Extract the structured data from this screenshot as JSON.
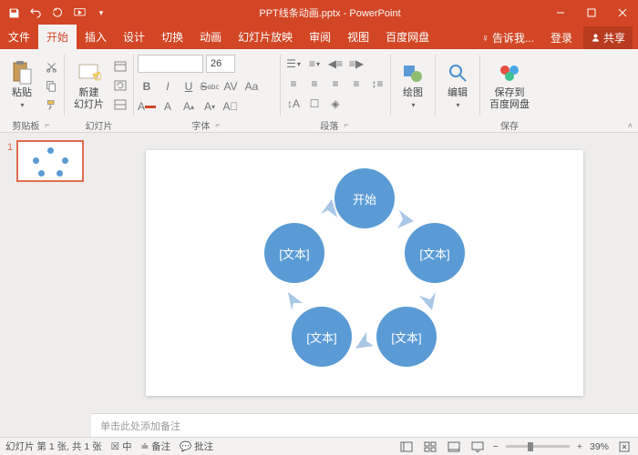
{
  "titlebar": {
    "title": "PPT线条动画.pptx - PowerPoint"
  },
  "tabs": {
    "file": "文件",
    "home": "开始",
    "insert": "插入",
    "design": "设计",
    "transitions": "切换",
    "animations": "动画",
    "slideshow": "幻灯片放映",
    "review": "审阅",
    "view": "视图",
    "baidu": "百度网盘",
    "tellme": "告诉我...",
    "login": "登录",
    "share": "共享"
  },
  "ribbon": {
    "clipboard": {
      "paste": "粘贴",
      "label": "剪贴板"
    },
    "slides": {
      "newSlide": "新建\n幻灯片",
      "label": "幻灯片"
    },
    "font": {
      "fontSize": "26",
      "label": "字体",
      "B": "B",
      "I": "I",
      "U": "U",
      "S": "S",
      "AV": "AV",
      "Aa": "Aa",
      "Ag": "A",
      "Al": "A"
    },
    "paragraph": {
      "label": "段落"
    },
    "drawing": {
      "draw": "绘图",
      "label": ""
    },
    "editing": {
      "edit": "编辑",
      "label": ""
    },
    "save": {
      "saveTo": "保存到\n百度网盘",
      "label": "保存"
    }
  },
  "thumbs": {
    "num": "1"
  },
  "slide": {
    "nodes": [
      "开始",
      "[文本]",
      "[文本]",
      "[文本]",
      "[文本]"
    ]
  },
  "notes": {
    "placeholder": "单击此处添加备注"
  },
  "statusbar": {
    "slideInfo": "幻灯片 第 1 张, 共 1 张",
    "lang": "",
    "notes": "备注",
    "comments": "批注",
    "zoom": "39%",
    "minus": "−",
    "plus": "+"
  }
}
